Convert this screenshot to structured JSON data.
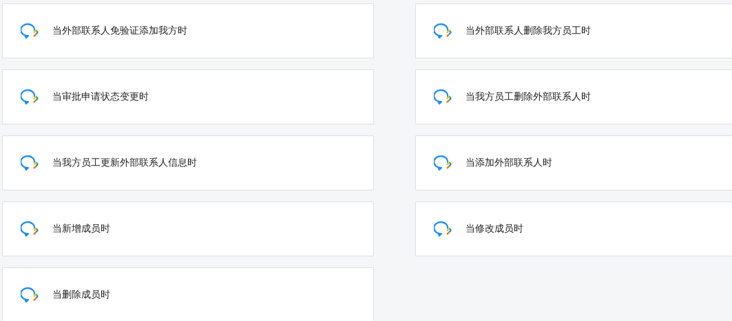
{
  "triggers": [
    {
      "label": "当外部联系人免验证添加我方时"
    },
    {
      "label": "当外部联系人删除我方员工时"
    },
    {
      "label": "当审批申请状态变更时"
    },
    {
      "label": "当我方员工删除外部联系人时"
    },
    {
      "label": "当我方员工更新外部联系人信息时"
    },
    {
      "label": "当添加外部联系人时"
    },
    {
      "label": "当新增成员时"
    },
    {
      "label": "当修改成员时"
    },
    {
      "label": "当删除成员时"
    }
  ]
}
